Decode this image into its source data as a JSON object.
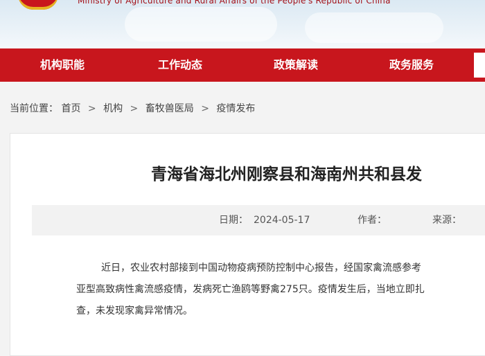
{
  "header": {
    "ministry_en": "Ministry of Agriculture and Rural Affairs of the People's Republic of China"
  },
  "nav": {
    "items": [
      "机构职能",
      "工作动态",
      "政策解读",
      "政务服务"
    ]
  },
  "breadcrumb": {
    "prefix": "当前位置：",
    "items": [
      "首页",
      "机构",
      "畜牧兽医局",
      "疫情发布"
    ],
    "separator": ">"
  },
  "article": {
    "title": "青海省海北州刚察县和海南州共和县发",
    "date_label": "日期：",
    "date": "2024-05-17",
    "author_label": "作者：",
    "source_label": "来源：",
    "paragraph_lines": [
      "近日，农业农村部接到中国动物疫病预防控制中心报告，经国家禽流感参考",
      "亚型高致病性禽流感疫情，发病死亡渔鸥等野禽275只。疫情发生后，当地立即扎",
      "查，未发现家禽异常情况。"
    ]
  },
  "colors": {
    "nav_red": "#c8161d",
    "page_bg": "#f3f3f3",
    "meta_bg": "#f2f2f2"
  }
}
